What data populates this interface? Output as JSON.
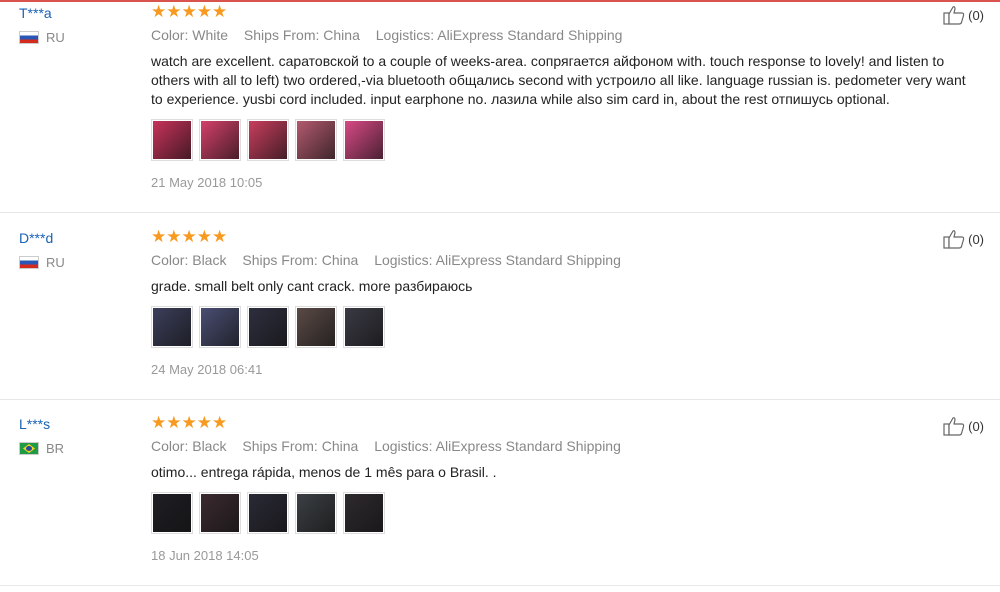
{
  "reviews": [
    {
      "user": "T***a",
      "country": "RU",
      "stars": "★★★★★",
      "color": "Color: White",
      "ships": "Ships From: China",
      "logistics": "Logistics: AliExpress Standard Shipping",
      "text": "watch are excellent. саратовской to a couple of weeks-area. сопрягается айфоном with. touch response to lovely! and listen to others with all to left) two ordered,-via bluetooth общались second with устроило all like. language russian is. pedometer very want to experience. yusbi cord included. input earphone no. лазила while also sim card in, about the rest отпишусь optional.",
      "date": "21 May 2018 10:05",
      "helpful": "(0)",
      "photo_colors": [
        "#c8325a",
        "#d4406a",
        "#c83e5e",
        "#b35a6e",
        "#d84a86"
      ]
    },
    {
      "user": "D***d",
      "country": "RU",
      "stars": "★★★★★",
      "color": "Color: Black",
      "ships": "Ships From: China",
      "logistics": "Logistics: AliExpress Standard Shipping",
      "text": "grade. small belt only cant crack. more разбираюсь",
      "date": "24 May 2018 06:41",
      "helpful": "(0)",
      "photo_colors": [
        "#3b3f5a",
        "#4a4e72",
        "#2e2f3e",
        "#5a4a46",
        "#3a3a44"
      ]
    },
    {
      "user": "L***s",
      "country": "BR",
      "stars": "★★★★★",
      "color": "Color: Black",
      "ships": "Ships From: China",
      "logistics": "Logistics: AliExpress Standard Shipping",
      "text": "otimo... entrega rápida, menos de 1 mês para o Brasil. .",
      "date": "18 Jun 2018 14:05",
      "helpful": "(0)",
      "photo_colors": [
        "#1e1e24",
        "#3a2a30",
        "#2a2a36",
        "#3c4044",
        "#2e2a2e"
      ]
    }
  ],
  "icons": {
    "like": "thumbs-up-icon",
    "star": "star-icon"
  },
  "accent": {
    "star": "#f79a1f",
    "username": "#1a62b8"
  }
}
